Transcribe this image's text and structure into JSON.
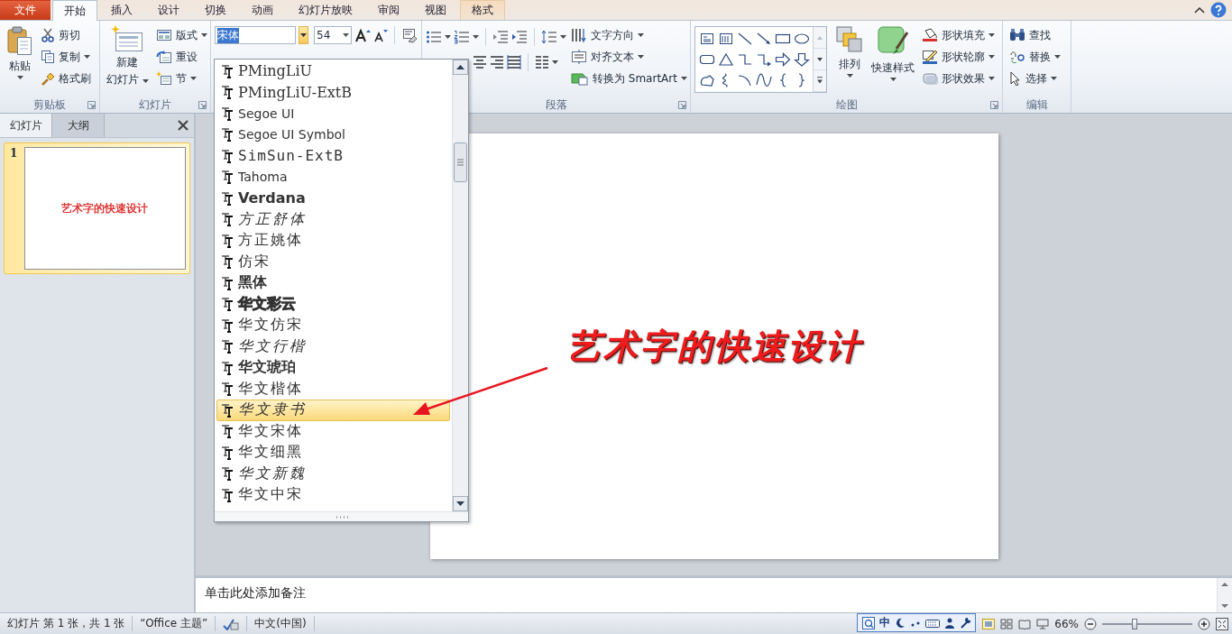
{
  "tabs": [
    {
      "label": "文件",
      "kind": "file",
      "selected": false
    },
    {
      "label": "开始",
      "kind": "normal",
      "selected": true
    },
    {
      "label": "插入",
      "kind": "normal",
      "selected": false
    },
    {
      "label": "设计",
      "kind": "normal",
      "selected": false
    },
    {
      "label": "切换",
      "kind": "normal",
      "selected": false
    },
    {
      "label": "动画",
      "kind": "normal",
      "selected": false
    },
    {
      "label": "幻灯片放映",
      "kind": "normal",
      "selected": false
    },
    {
      "label": "审阅",
      "kind": "normal",
      "selected": false
    },
    {
      "label": "视图",
      "kind": "normal",
      "selected": false
    },
    {
      "label": "格式",
      "kind": "contextual",
      "selected": false
    }
  ],
  "ribbon": {
    "clipboard": {
      "label": "剪贴板",
      "paste": "粘贴",
      "cut": "剪切",
      "copy": "复制",
      "format_painter": "格式刷"
    },
    "slides": {
      "label": "幻灯片",
      "new_slide": [
        "新建",
        "幻灯片"
      ],
      "layout": "版式",
      "reset": "重设",
      "section": "节"
    },
    "font": {
      "font_name": "宋体",
      "font_size": "54"
    },
    "paragraph": {
      "label": "段落",
      "text_direction": "文字方向",
      "align_text": "对齐文本",
      "convert_smartart": "转换为 SmartArt"
    },
    "drawing": {
      "label": "绘图",
      "arrange": "排列",
      "quick_styles": "快速样式",
      "shape_fill": "形状填充",
      "shape_outline": "形状轮廓",
      "shape_effects": "形状效果"
    },
    "editing": {
      "label": "编辑",
      "find": "查找",
      "replace": "替换",
      "select": "选择"
    }
  },
  "font_dropdown": {
    "items": [
      {
        "label": "PMingLiU",
        "kind": "serif",
        "selected": false
      },
      {
        "label": "PMingLiU-ExtB",
        "kind": "serif",
        "selected": false
      },
      {
        "label": "Segoe UI",
        "kind": "sans",
        "selected": false
      },
      {
        "label": "Segoe UI Symbol",
        "kind": "sans",
        "selected": false
      },
      {
        "label": "SimSun-ExtB",
        "kind": "mono",
        "selected": false
      },
      {
        "label": "Tahoma",
        "kind": "sans",
        "selected": false
      },
      {
        "label": "Verdana",
        "kind": "bold",
        "selected": false
      },
      {
        "label": "方正舒体",
        "kind": "script",
        "selected": false
      },
      {
        "label": "方正姚体",
        "kind": "plain",
        "selected": false
      },
      {
        "label": "仿宋",
        "kind": "plain",
        "selected": false
      },
      {
        "label": "黑体",
        "kind": "bold",
        "selected": false
      },
      {
        "label": "华文彩云",
        "kind": "outline",
        "selected": false
      },
      {
        "label": "华文仿宋",
        "kind": "plain",
        "selected": false
      },
      {
        "label": "华文行楷",
        "kind": "script",
        "selected": false
      },
      {
        "label": "华文琥珀",
        "kind": "bold",
        "selected": false
      },
      {
        "label": "华文楷体",
        "kind": "plain",
        "selected": false
      },
      {
        "label": "华文隶书",
        "kind": "script",
        "selected": true
      },
      {
        "label": "华文宋体",
        "kind": "plain",
        "selected": false
      },
      {
        "label": "华文细黑",
        "kind": "plain",
        "selected": false
      },
      {
        "label": "华文新魏",
        "kind": "script",
        "selected": false
      },
      {
        "label": "华文中宋",
        "kind": "plain",
        "selected": false
      }
    ]
  },
  "slides_panel": {
    "tabs": [
      {
        "label": "幻灯片",
        "selected": true
      },
      {
        "label": "大纲",
        "selected": false
      }
    ],
    "thumbnails": [
      {
        "number": "1",
        "title": "艺术字的快速设计",
        "selected": true
      }
    ]
  },
  "slide": {
    "wordart": "艺术字的快速设计"
  },
  "notes": {
    "placeholder": "单击此处添加备注"
  },
  "status_bar": {
    "slide_info": "幻灯片 第 1 张，共 1 张",
    "theme": "“Office 主题”",
    "language": "中文(中国)",
    "zoom": "66%",
    "zoom_slider": {
      "level": 0.36
    }
  },
  "language_bar": {
    "mode": "中"
  }
}
